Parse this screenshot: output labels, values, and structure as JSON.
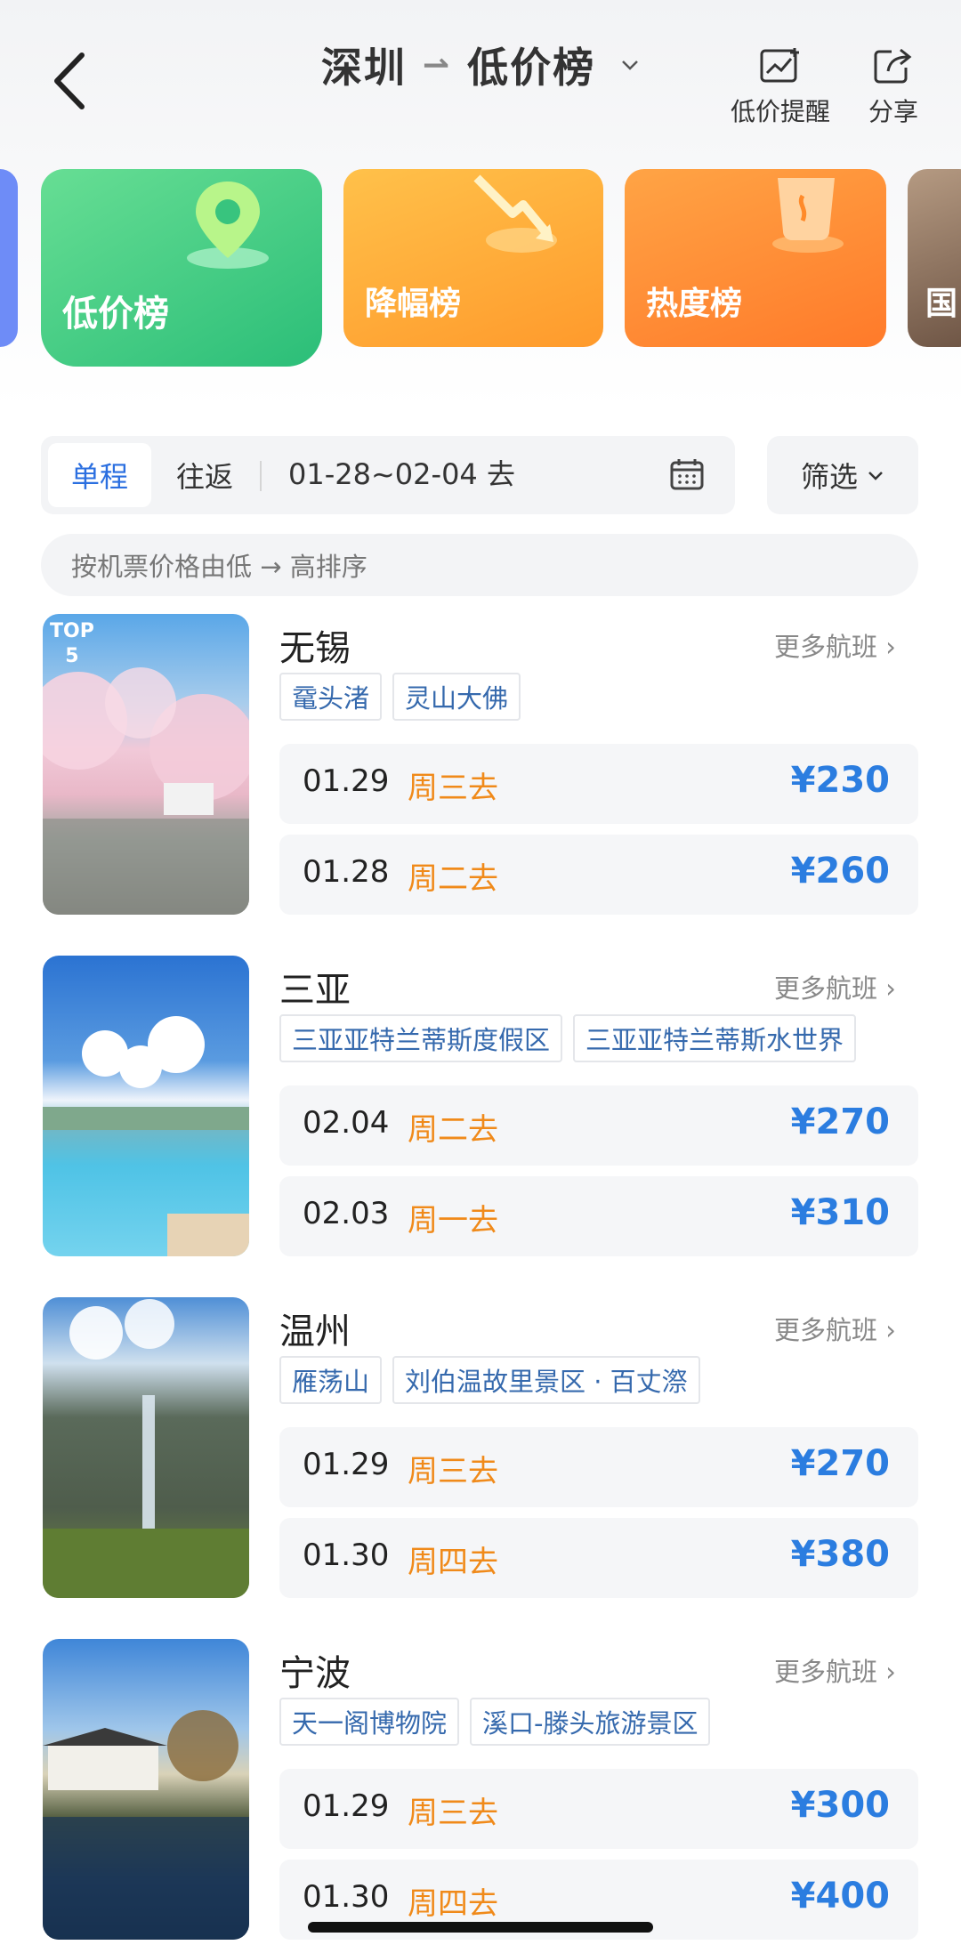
{
  "header": {
    "origin": "深圳",
    "destination": "低价榜",
    "actions": [
      {
        "label": "低价提醒",
        "icon": "price-alert-icon"
      },
      {
        "label": "分享",
        "icon": "share-icon"
      }
    ]
  },
  "categories": [
    {
      "label": "低价榜",
      "selected": true
    },
    {
      "label": "降幅榜"
    },
    {
      "label": "热度榜"
    },
    {
      "label": "国"
    }
  ],
  "filters": {
    "trip_types": [
      "单程",
      "往返"
    ],
    "selected_trip_type": "单程",
    "date_range": "01-28~02-04 去",
    "filter_label": "筛选",
    "sort_hint": "按机票价格由低 → 高排序"
  },
  "list": [
    {
      "rank_badge": [
        "TOP",
        "5"
      ],
      "city": "无锡",
      "more": "更多航班",
      "tags": [
        "鼋头渚",
        "灵山大佛"
      ],
      "flights": [
        {
          "date": "01.29",
          "weekday": "周三去",
          "price": "¥230"
        },
        {
          "date": "01.28",
          "weekday": "周二去",
          "price": "¥260"
        }
      ]
    },
    {
      "city": "三亚",
      "more": "更多航班",
      "tags": [
        "三亚亚特兰蒂斯度假区",
        "三亚亚特兰蒂斯水世界"
      ],
      "flights": [
        {
          "date": "02.04",
          "weekday": "周二去",
          "price": "¥270"
        },
        {
          "date": "02.03",
          "weekday": "周一去",
          "price": "¥310"
        }
      ]
    },
    {
      "city": "温州",
      "more": "更多航班",
      "tags": [
        "雁荡山",
        "刘伯温故里景区 · 百丈漈"
      ],
      "flights": [
        {
          "date": "01.29",
          "weekday": "周三去",
          "price": "¥270"
        },
        {
          "date": "01.30",
          "weekday": "周四去",
          "price": "¥380"
        }
      ]
    },
    {
      "city": "宁波",
      "more": "更多航班",
      "tags": [
        "天一阁博物院",
        "溪口-滕头旅游景区"
      ],
      "flights": [
        {
          "date": "01.29",
          "weekday": "周三去",
          "price": "¥300"
        },
        {
          "date": "01.30",
          "weekday": "周四去",
          "price": "¥400"
        }
      ]
    }
  ],
  "colors": {
    "accent_blue": "#2b7de0",
    "weekday_orange": "#f08a1a",
    "tag_blue": "#3569ad",
    "card_green": "#2bbe78",
    "card_orange": "#ff9a2c"
  }
}
